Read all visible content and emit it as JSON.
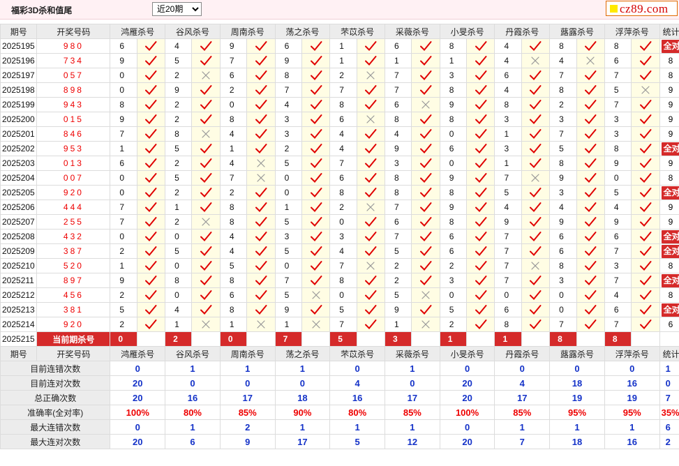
{
  "header": {
    "title": "福彩3D杀和值尾",
    "period_select": "近20期",
    "logo": "cz89.com"
  },
  "columns": {
    "issue": "期号",
    "draw": "开奖号码",
    "experts": [
      "鸿雁杀号",
      "谷风杀号",
      "周南杀号",
      "荡之杀号",
      "芣苡杀号",
      "采薇杀号",
      "小旻杀号",
      "丹霞杀号",
      "蕗露杀号",
      "浮萍杀号"
    ],
    "stat": "统计"
  },
  "rows": [
    {
      "issue": "2025195",
      "draw": "980",
      "kills": [
        6,
        4,
        9,
        6,
        1,
        6,
        8,
        4,
        8,
        8
      ],
      "marks": [
        1,
        1,
        1,
        1,
        1,
        1,
        1,
        1,
        1,
        1
      ],
      "stat": "全对"
    },
    {
      "issue": "2025196",
      "draw": "734",
      "kills": [
        9,
        5,
        7,
        9,
        1,
        1,
        1,
        4,
        4,
        6
      ],
      "marks": [
        1,
        1,
        1,
        1,
        1,
        1,
        1,
        0,
        0,
        1
      ],
      "stat": "8"
    },
    {
      "issue": "2025197",
      "draw": "057",
      "kills": [
        0,
        2,
        6,
        8,
        2,
        7,
        3,
        6,
        7,
        7
      ],
      "marks": [
        1,
        0,
        1,
        1,
        0,
        1,
        1,
        1,
        1,
        1
      ],
      "stat": "8"
    },
    {
      "issue": "2025198",
      "draw": "898",
      "kills": [
        0,
        9,
        2,
        7,
        7,
        7,
        8,
        4,
        8,
        5
      ],
      "marks": [
        1,
        1,
        1,
        1,
        1,
        1,
        1,
        1,
        1,
        0
      ],
      "stat": "9"
    },
    {
      "issue": "2025199",
      "draw": "943",
      "kills": [
        8,
        2,
        0,
        4,
        8,
        6,
        9,
        8,
        2,
        7
      ],
      "marks": [
        1,
        1,
        1,
        1,
        1,
        0,
        1,
        1,
        1,
        1
      ],
      "stat": "9"
    },
    {
      "issue": "2025200",
      "draw": "015",
      "kills": [
        9,
        2,
        8,
        3,
        6,
        8,
        8,
        3,
        3,
        3
      ],
      "marks": [
        1,
        1,
        1,
        1,
        0,
        1,
        1,
        1,
        1,
        1
      ],
      "stat": "9"
    },
    {
      "issue": "2025201",
      "draw": "846",
      "kills": [
        7,
        8,
        4,
        3,
        4,
        4,
        0,
        1,
        7,
        3
      ],
      "marks": [
        1,
        0,
        1,
        1,
        1,
        1,
        1,
        1,
        1,
        1
      ],
      "stat": "9"
    },
    {
      "issue": "2025202",
      "draw": "953",
      "kills": [
        1,
        5,
        1,
        2,
        4,
        9,
        6,
        3,
        5,
        8
      ],
      "marks": [
        1,
        1,
        1,
        1,
        1,
        1,
        1,
        1,
        1,
        1
      ],
      "stat": "全对"
    },
    {
      "issue": "2025203",
      "draw": "013",
      "kills": [
        6,
        2,
        4,
        5,
        7,
        3,
        0,
        1,
        8,
        9
      ],
      "marks": [
        1,
        1,
        0,
        1,
        1,
        1,
        1,
        1,
        1,
        1
      ],
      "stat": "9"
    },
    {
      "issue": "2025204",
      "draw": "007",
      "kills": [
        0,
        5,
        7,
        0,
        6,
        8,
        9,
        7,
        9,
        0
      ],
      "marks": [
        1,
        1,
        0,
        1,
        1,
        1,
        1,
        0,
        1,
        1
      ],
      "stat": "8"
    },
    {
      "issue": "2025205",
      "draw": "920",
      "kills": [
        0,
        2,
        2,
        0,
        8,
        8,
        8,
        5,
        3,
        5
      ],
      "marks": [
        1,
        1,
        1,
        1,
        1,
        1,
        1,
        1,
        1,
        1
      ],
      "stat": "全对"
    },
    {
      "issue": "2025206",
      "draw": "444",
      "kills": [
        7,
        1,
        8,
        1,
        2,
        7,
        9,
        4,
        4,
        4
      ],
      "marks": [
        1,
        1,
        1,
        1,
        0,
        1,
        1,
        1,
        1,
        1
      ],
      "stat": "9"
    },
    {
      "issue": "2025207",
      "draw": "255",
      "kills": [
        7,
        2,
        8,
        5,
        0,
        6,
        8,
        9,
        9,
        9
      ],
      "marks": [
        1,
        0,
        1,
        1,
        1,
        1,
        1,
        1,
        1,
        1
      ],
      "stat": "9"
    },
    {
      "issue": "2025208",
      "draw": "432",
      "kills": [
        0,
        0,
        4,
        3,
        3,
        7,
        6,
        7,
        6,
        6
      ],
      "marks": [
        1,
        1,
        1,
        1,
        1,
        1,
        1,
        1,
        1,
        1
      ],
      "stat": "全对"
    },
    {
      "issue": "2025209",
      "draw": "387",
      "kills": [
        2,
        5,
        4,
        5,
        4,
        5,
        6,
        7,
        6,
        7
      ],
      "marks": [
        1,
        1,
        1,
        1,
        1,
        1,
        1,
        1,
        1,
        1
      ],
      "stat": "全对"
    },
    {
      "issue": "2025210",
      "draw": "520",
      "kills": [
        1,
        0,
        5,
        0,
        7,
        2,
        2,
        7,
        8,
        3
      ],
      "marks": [
        1,
        1,
        1,
        1,
        0,
        1,
        1,
        0,
        1,
        1
      ],
      "stat": "8"
    },
    {
      "issue": "2025211",
      "draw": "897",
      "kills": [
        9,
        8,
        8,
        7,
        8,
        2,
        3,
        7,
        3,
        7
      ],
      "marks": [
        1,
        1,
        1,
        1,
        1,
        1,
        1,
        1,
        1,
        1
      ],
      "stat": "全对"
    },
    {
      "issue": "2025212",
      "draw": "456",
      "kills": [
        2,
        0,
        6,
        5,
        0,
        5,
        0,
        0,
        0,
        4
      ],
      "marks": [
        1,
        1,
        1,
        0,
        1,
        0,
        1,
        1,
        1,
        1
      ],
      "stat": "8"
    },
    {
      "issue": "2025213",
      "draw": "381",
      "kills": [
        5,
        4,
        8,
        9,
        5,
        9,
        5,
        6,
        0,
        6
      ],
      "marks": [
        1,
        1,
        1,
        1,
        1,
        1,
        1,
        1,
        1,
        1
      ],
      "stat": "全对"
    },
    {
      "issue": "2025214",
      "draw": "920",
      "kills": [
        2,
        1,
        1,
        1,
        7,
        1,
        2,
        8,
        7,
        7
      ],
      "marks": [
        1,
        0,
        0,
        0,
        1,
        0,
        1,
        1,
        1,
        1
      ],
      "stat": "6"
    }
  ],
  "current": {
    "issue": "2025215",
    "label": "当前期杀号",
    "kills": [
      0,
      2,
      0,
      7,
      5,
      3,
      1,
      1,
      8,
      8
    ]
  },
  "summary": [
    {
      "label": "目前连错次数",
      "values": [
        "0",
        "1",
        "1",
        "1",
        "0",
        "1",
        "0",
        "0",
        "0",
        "0"
      ],
      "last": "1",
      "kind": "num"
    },
    {
      "label": "目前连对次数",
      "values": [
        "20",
        "0",
        "0",
        "0",
        "4",
        "0",
        "20",
        "4",
        "18",
        "16"
      ],
      "last": "0",
      "kind": "num"
    },
    {
      "label": "总正确次数",
      "values": [
        "20",
        "16",
        "17",
        "18",
        "16",
        "17",
        "20",
        "17",
        "19",
        "19"
      ],
      "last": "7",
      "kind": "num"
    },
    {
      "label": "准确率(全对率)",
      "values": [
        "100%",
        "80%",
        "85%",
        "90%",
        "80%",
        "85%",
        "100%",
        "85%",
        "95%",
        "95%"
      ],
      "last": "35%",
      "kind": "pct"
    },
    {
      "label": "最大连错次数",
      "values": [
        "0",
        "1",
        "2",
        "1",
        "1",
        "1",
        "0",
        "1",
        "1",
        "1"
      ],
      "last": "6",
      "kind": "num"
    },
    {
      "label": "最大连对次数",
      "values": [
        "20",
        "6",
        "9",
        "17",
        "5",
        "12",
        "20",
        "7",
        "18",
        "16"
      ],
      "last": "2",
      "kind": "num"
    }
  ],
  "colors": {
    "check": "#e00000",
    "cross": "#999999",
    "badge": "#d52a2a",
    "summary_value": "#1432c8"
  }
}
